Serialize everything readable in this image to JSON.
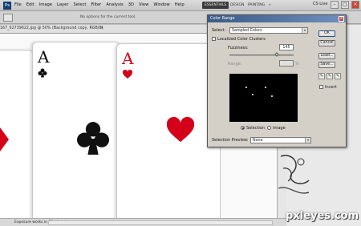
{
  "app": {
    "logo": "Ps",
    "menu": [
      "File",
      "Edit",
      "Image",
      "Layer",
      "Select",
      "Filter",
      "Analysis",
      "3D",
      "View",
      "Window",
      "Help"
    ],
    "workspaces": [
      "ESSENTIALS",
      "DESIGN",
      "PAINTING",
      "»"
    ],
    "cs_live": "CS Live"
  },
  "options_bar": {
    "message": "No options for the current tool."
  },
  "document": {
    "tab_name": "167_92739622.jpg @ 50% (Background copy, RGB/8)",
    "close": "×",
    "status": "Exposure works in 32-bit only"
  },
  "cards": [
    {
      "rank": "",
      "suit": "diamond",
      "color": "#d4001a"
    },
    {
      "rank": "A",
      "suit": "club",
      "color": "#111111"
    },
    {
      "rank": "A",
      "suit": "heart",
      "color": "#d4001a"
    }
  ],
  "dialog": {
    "title": "Color Range",
    "close": "x",
    "select_label": "Select:",
    "select_value": "Sampled Colors",
    "localized_label": "Localized Color Clusters",
    "fuzziness_label": "Fuzziness:",
    "fuzziness_value": "145",
    "range_label": "Range:",
    "range_unit": "%",
    "selection_radio": "Selection",
    "image_radio": "Image",
    "selection_preview_label": "Selection Preview:",
    "selection_preview_value": "None",
    "buttons": {
      "ok": "OK",
      "cancel": "Cancel",
      "load": "Load...",
      "save": "Save..."
    },
    "invert_label": "Invert"
  },
  "watermark": "pxleyes.com"
}
